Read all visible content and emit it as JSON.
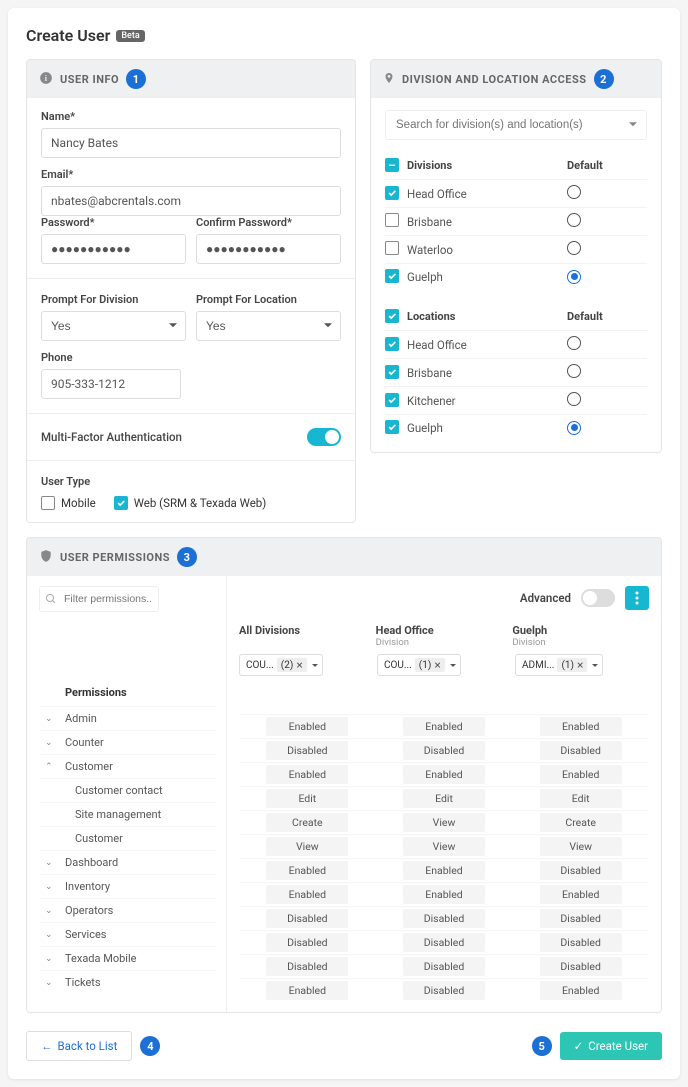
{
  "page": {
    "title": "Create User",
    "beta": "Beta"
  },
  "userInfo": {
    "header": "USER INFO",
    "badge": "1",
    "labels": {
      "name": "Name*",
      "email": "Email*",
      "password": "Password*",
      "confirm": "Confirm Password*",
      "promptDiv": "Prompt For Division",
      "promptLoc": "Prompt For Location",
      "phone": "Phone",
      "mfa": "Multi-Factor Authentication",
      "userType": "User Type"
    },
    "values": {
      "name": "Nancy Bates",
      "email": "nbates@abcrentals.com",
      "password": "●●●●●●●●●●●",
      "confirm": "●●●●●●●●●●●",
      "promptDiv": "Yes",
      "promptLoc": "Yes",
      "phone": "905-333-1212"
    },
    "userType": {
      "mobile": {
        "label": "Mobile",
        "checked": false
      },
      "web": {
        "label": "Web (SRM & Texada Web)",
        "checked": true
      }
    }
  },
  "divLoc": {
    "header": "DIVISION AND LOCATION ACCESS",
    "badge": "2",
    "searchPlaceholder": "Search for division(s) and location(s)",
    "divLabel": "Divisions",
    "defaultLabel": "Default",
    "divisions": [
      {
        "name": "Head Office",
        "checked": true,
        "default": false
      },
      {
        "name": "Brisbane",
        "checked": false,
        "default": false
      },
      {
        "name": "Waterloo",
        "checked": false,
        "default": false
      },
      {
        "name": "Guelph",
        "checked": true,
        "default": true
      }
    ],
    "locLabel": "Locations",
    "locations": [
      {
        "name": "Head Office",
        "checked": true,
        "default": false
      },
      {
        "name": "Brisbane",
        "checked": true,
        "default": false
      },
      {
        "name": "Kitchener",
        "checked": true,
        "default": false
      },
      {
        "name": "Guelph",
        "checked": true,
        "default": true
      }
    ]
  },
  "perms": {
    "header": "USER PERMISSIONS",
    "badge": "3",
    "filterPlaceholder": "Filter permissions...",
    "advancedLabel": "Advanced",
    "permHeading": "Permissions",
    "columns": [
      {
        "name": "All Divisions",
        "sub": "",
        "tag": "COU...",
        "count": "(2)",
        "showX": true,
        "showDd": true
      },
      {
        "name": "Head Office",
        "sub": "Division",
        "tag": "COU...",
        "count": "(1)",
        "showX": true,
        "showDd": true
      },
      {
        "name": "Guelph",
        "sub": "Division",
        "tag": "ADMI...",
        "count": "(1)",
        "showX": true,
        "showDd": true
      }
    ],
    "rows": [
      {
        "label": "Admin",
        "type": "group",
        "exp": "v",
        "vals": [
          "Enabled",
          "Enabled",
          "Enabled"
        ]
      },
      {
        "label": "Counter",
        "type": "group",
        "exp": "v",
        "vals": [
          "Disabled",
          "Disabled",
          "Disabled"
        ]
      },
      {
        "label": "Customer",
        "type": "group",
        "exp": "^",
        "vals": [
          "Enabled",
          "Enabled",
          "Enabled"
        ]
      },
      {
        "label": "Customer contact",
        "type": "sub",
        "vals": [
          "Edit",
          "Edit",
          "Edit"
        ]
      },
      {
        "label": "Site management",
        "type": "sub",
        "vals": [
          "Create",
          "View",
          "Create"
        ]
      },
      {
        "label": "Customer",
        "type": "sub",
        "vals": [
          "View",
          "View",
          "View"
        ]
      },
      {
        "label": "Dashboard",
        "type": "group",
        "exp": "v",
        "vals": [
          "Enabled",
          "Enabled",
          "Disabled"
        ]
      },
      {
        "label": "Inventory",
        "type": "group",
        "exp": "v",
        "vals": [
          "Enabled",
          "Enabled",
          "Enabled"
        ]
      },
      {
        "label": "Operators",
        "type": "group",
        "exp": "v",
        "vals": [
          "Disabled",
          "Disabled",
          "Disabled"
        ]
      },
      {
        "label": "Services",
        "type": "group",
        "exp": "v",
        "vals": [
          "Disabled",
          "Disabled",
          "Disabled"
        ]
      },
      {
        "label": "Texada Mobile",
        "type": "group",
        "exp": "v",
        "vals": [
          "Disabled",
          "Disabled",
          "Disabled"
        ]
      },
      {
        "label": "Tickets",
        "type": "group",
        "exp": "v",
        "vals": [
          "Enabled",
          "Disabled",
          "Enabled"
        ]
      }
    ]
  },
  "footer": {
    "back": "Back to List",
    "backBadge": "4",
    "create": "Create User",
    "createBadge": "5"
  }
}
